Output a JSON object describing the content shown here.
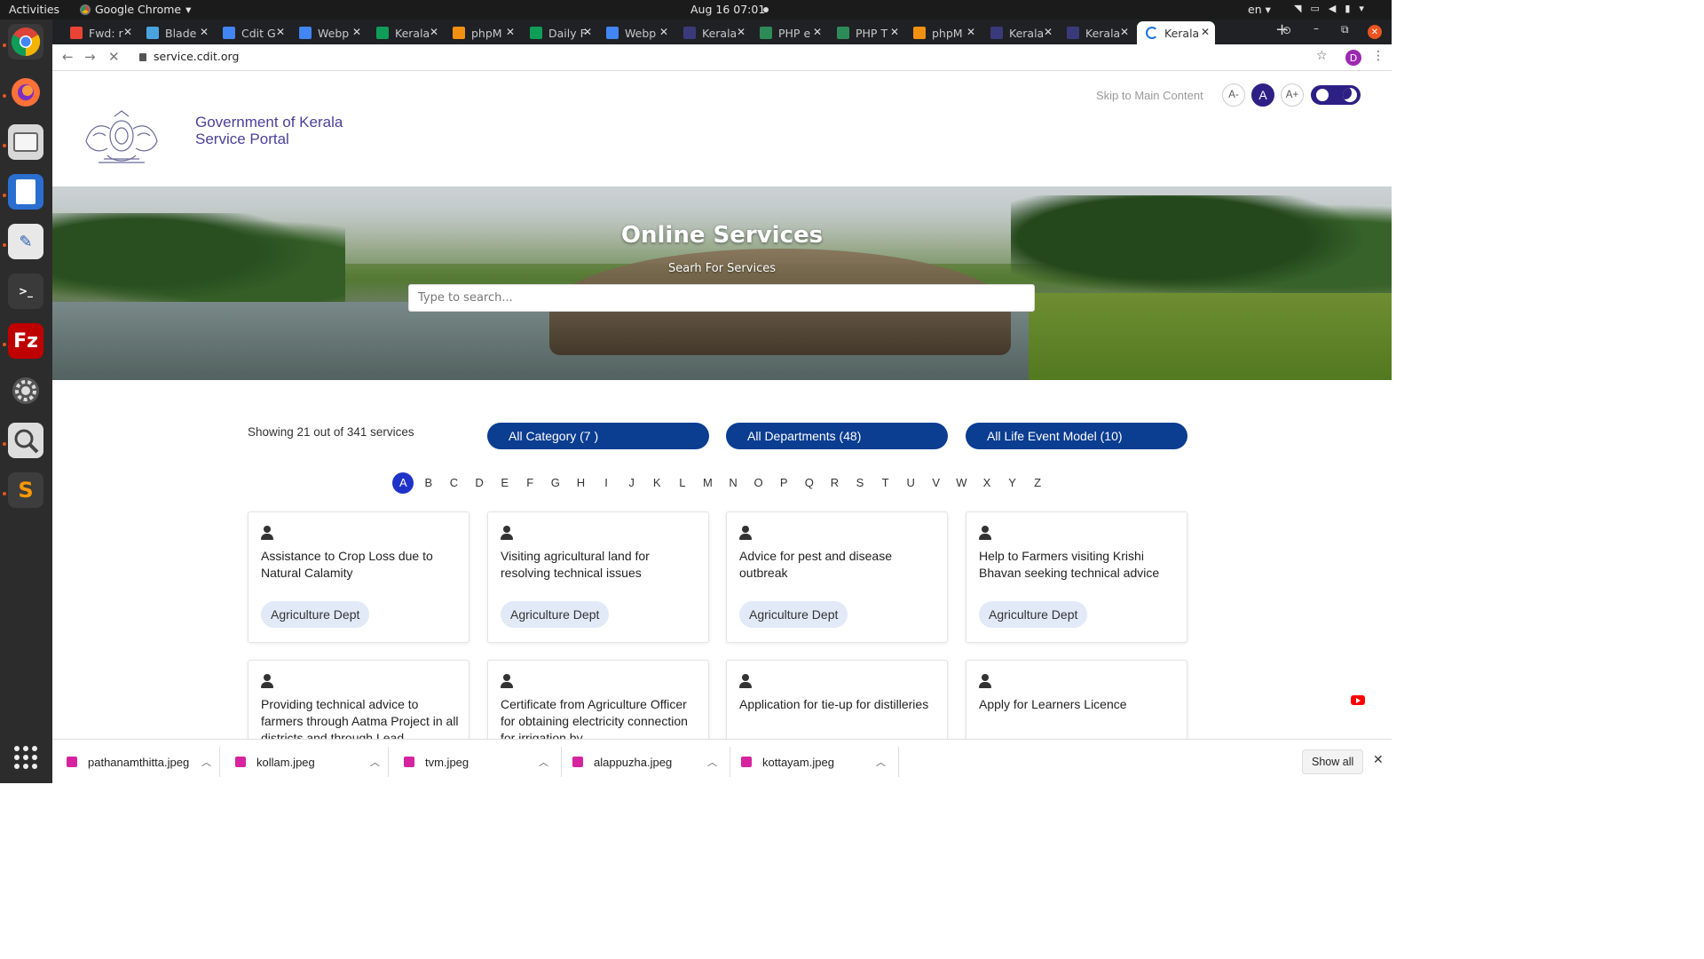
{
  "topbar": {
    "activities": "Activities",
    "app_name": "Google Chrome",
    "clock": "Aug 16  07:01",
    "lang": "en"
  },
  "tabs": [
    {
      "title": "Fwd: r",
      "fav_color": "#ea4335"
    },
    {
      "title": "Blade",
      "fav_color": "#4aa3df"
    },
    {
      "title": "Cdit G",
      "fav_color": "#4285f4"
    },
    {
      "title": "Webp",
      "fav_color": "#4285f4"
    },
    {
      "title": "Kerala",
      "fav_color": "#0f9d58"
    },
    {
      "title": "phpM",
      "fav_color": "#f29111"
    },
    {
      "title": "Daily F",
      "fav_color": "#0f9d58"
    },
    {
      "title": "Webp",
      "fav_color": "#4285f4"
    },
    {
      "title": "Kerala",
      "fav_color": "#3a3a7a"
    },
    {
      "title": "PHP e",
      "fav_color": "#2e8b57"
    },
    {
      "title": "PHP T",
      "fav_color": "#2e8b57"
    },
    {
      "title": "phpM",
      "fav_color": "#f29111"
    },
    {
      "title": "Kerala",
      "fav_color": "#3a3a7a"
    },
    {
      "title": "Kerala",
      "fav_color": "#3a3a7a"
    },
    {
      "title": "Kerala",
      "fav_color": "#1a73e8"
    }
  ],
  "browser": {
    "url": "service.cdit.org",
    "profile_initial": "D"
  },
  "header": {
    "brand_line1": "Government of Kerala",
    "brand_line2": "Service Portal",
    "skip_link": "Skip to Main Content",
    "font_decrease": "A-",
    "font_normal": "A",
    "font_increase": "A+"
  },
  "hero": {
    "title": "Online Services",
    "subtitle": "Searh For Services",
    "search_placeholder": "Type to search..."
  },
  "filters": {
    "showing": "Showing 21 out of 341 services",
    "category": "All Category (7 )",
    "departments": "All Departments (48)",
    "life_event": "All Life Event Model (10)"
  },
  "alphabet": [
    "A",
    "B",
    "C",
    "D",
    "E",
    "F",
    "G",
    "H",
    "I",
    "J",
    "K",
    "L",
    "M",
    "N",
    "O",
    "P",
    "Q",
    "R",
    "S",
    "T",
    "U",
    "V",
    "W",
    "X",
    "Y",
    "Z"
  ],
  "selected_letter": "A",
  "services": [
    {
      "title": "Assistance to Crop Loss due to Natural Calamity",
      "dept": "Agriculture Dept"
    },
    {
      "title": "Visiting agricultural land for resolving technical issues",
      "dept": "Agriculture Dept"
    },
    {
      "title": "Advice for pest and disease outbreak",
      "dept": "Agriculture Dept"
    },
    {
      "title": "Help to Farmers visiting Krishi Bhavan seeking technical advice",
      "dept": "Agriculture Dept"
    },
    {
      "title": "Providing technical advice to farmers through Aatma Project in all districts and through Lead",
      "dept": ""
    },
    {
      "title": "Certificate from Agriculture Officer for obtaining electricity connection for irrigation by",
      "dept": ""
    },
    {
      "title": "Application for tie-up for distilleries",
      "dept": ""
    },
    {
      "title": "Apply for Learners Licence",
      "dept": ""
    }
  ],
  "downloads": [
    {
      "name": "pathanamthitta.jpeg"
    },
    {
      "name": "kollam.jpeg"
    },
    {
      "name": "tvm.jpeg"
    },
    {
      "name": "alappuzha.jpeg"
    },
    {
      "name": "kottayam.jpeg"
    }
  ],
  "shelf": {
    "show_all": "Show all"
  },
  "colors": {
    "brand_purple": "#4b3f9a",
    "filter_blue": "#0b3d91",
    "letter_selected": "#1f33c8",
    "badge_bg": "#e2e9f7"
  }
}
